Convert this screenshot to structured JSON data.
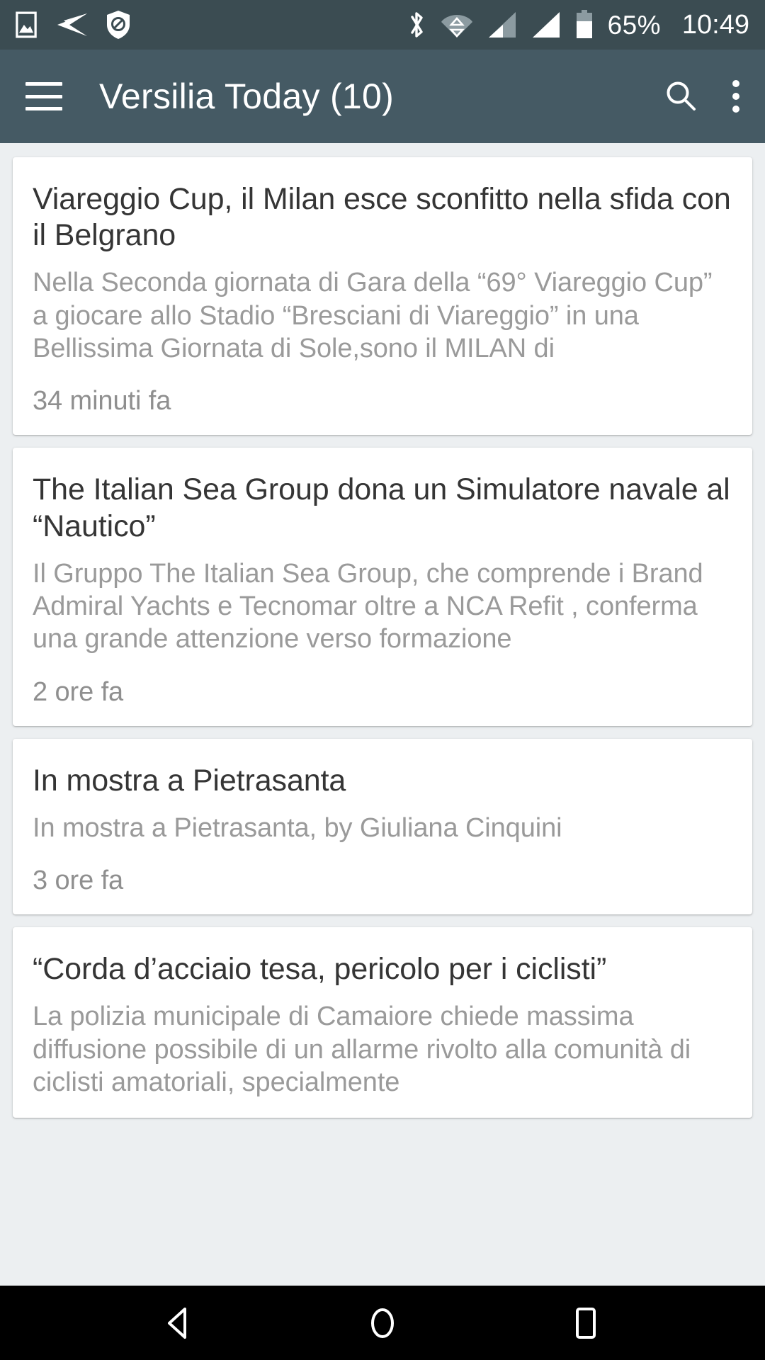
{
  "status_bar": {
    "left_icons": [
      {
        "name": "image-icon",
        "label": "screenshot"
      },
      {
        "name": "telegram-icon",
        "label": "telegram"
      },
      {
        "name": "shield-block-icon",
        "label": "blocker"
      }
    ],
    "right_icons": [
      {
        "name": "bluetooth-icon",
        "label": "bluetooth"
      },
      {
        "name": "wifi-icon",
        "label": "wifi"
      },
      {
        "name": "signal-1-icon",
        "label": "signal sim 1"
      },
      {
        "name": "signal-2-icon",
        "label": "signal sim 2"
      },
      {
        "name": "battery-icon",
        "label": "battery"
      }
    ],
    "battery_percent": "65%",
    "clock": "10:49"
  },
  "app_bar": {
    "menu_icon": "hamburger-menu-icon",
    "title": "Versilia Today (10)",
    "search_icon": "search-icon",
    "overflow_icon": "more-options-icon",
    "background_color": "#455a64"
  },
  "articles": [
    {
      "title": "Viareggio Cup, il Milan esce sconfitto nella sfida con il Belgrano",
      "body": "Nella Seconda giornata di Gara della “69° Viareggio Cup” a giocare allo Stadio “Bresciani di Viareggio” in una Bellissima Giornata di Sole,sono il MILAN di",
      "time": "34 minuti fa"
    },
    {
      "title": "The Italian Sea Group dona un Simulatore navale al “Nautico”",
      "body": "Il Gruppo The Italian Sea Group, che comprende i Brand Admiral Yachts e Tecnomar oltre a NCA Refit , conferma una grande attenzione verso formazione",
      "time": "2 ore fa"
    },
    {
      "title": "In mostra a Pietrasanta",
      "body": "In mostra a Pietrasanta, by Giuliana Cinquini",
      "time": "3 ore fa"
    },
    {
      "title": "“Corda d’acciaio tesa, pericolo per i ciclisti”",
      "body": "La polizia municipale di Camaiore chiede massima diffusione possibile di un allarme rivolto alla comunità di ciclisti amatoriali, specialmente",
      "time": ""
    }
  ],
  "nav_bar": {
    "back_icon": "back-triangle-icon",
    "home_icon": "home-circle-icon",
    "recents_icon": "recents-square-icon",
    "background_color": "#000000"
  }
}
